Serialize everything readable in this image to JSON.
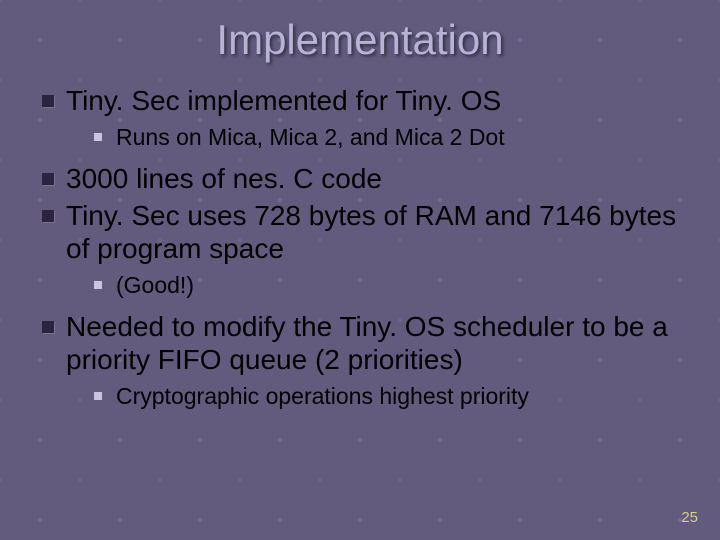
{
  "title": "Implementation",
  "bullets": {
    "b0": "Tiny. Sec implemented for Tiny. OS",
    "b0_sub0": "Runs on Mica, Mica 2, and Mica 2 Dot",
    "b1": "3000 lines of nes. C code",
    "b2": "Tiny. Sec uses 728 bytes of RAM and 7146 bytes of program space",
    "b2_sub0": "(Good!)",
    "b3": "Needed to modify the Tiny. OS scheduler to be a priority FIFO queue (2 priorities)",
    "b3_sub0": "Cryptographic operations highest priority"
  },
  "page_number": "25"
}
